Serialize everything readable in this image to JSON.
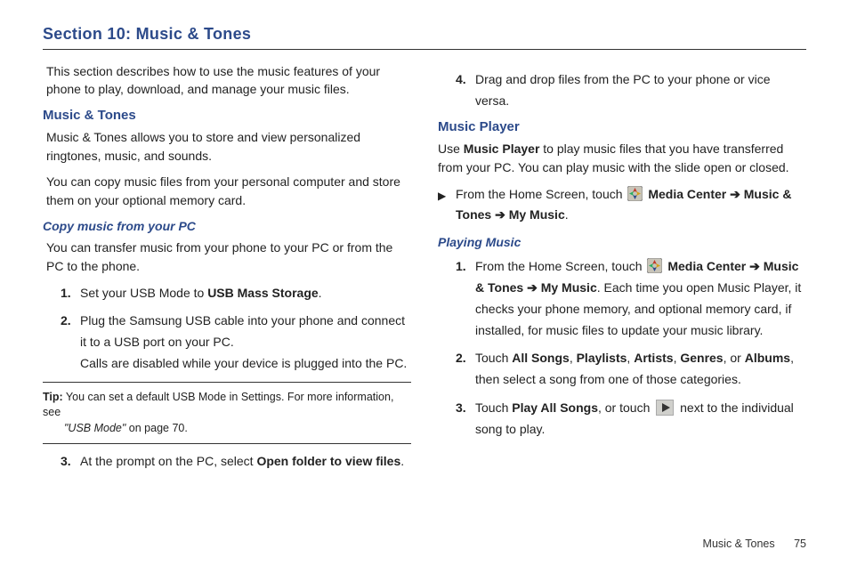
{
  "section_title": "Section 10:  Music & Tones",
  "left": {
    "intro": "This section describes how to use the music features of your phone to play, download, and manage your music files.",
    "h1": "Music & Tones",
    "p1": "Music & Tones allows you to store and view personalized ringtones, music, and sounds.",
    "p2": "You can copy music files from your personal computer and store them on your optional memory card.",
    "h2": "Copy music from your PC",
    "p3": "You can transfer music from your phone to your PC or from the PC to the phone.",
    "steps": {
      "s1_a": "Set your USB Mode to ",
      "s1_b": "USB Mass Storage",
      "s1_c": ".",
      "s2_a": "Plug the Samsung USB cable into your phone and connect it to a USB port on your PC.",
      "s2_b": "Calls are disabled while your device is plugged into the PC.",
      "s3_a": "At the prompt on the PC, select ",
      "s3_b": "Open folder to view files",
      "s3_c": "."
    },
    "tip": {
      "label": "Tip:",
      "line1": " You can set a default USB Mode in Settings. For more information, see",
      "line2a": "\"USB Mode\"",
      "line2b": " on page 70."
    }
  },
  "right": {
    "s4": "Drag and drop files from the PC to your phone or vice versa.",
    "h1": "Music Player",
    "p1a": "Use ",
    "p1b": "Music Player",
    "p1c": " to play music files that you have transferred from your PC. You can play music with the slide open or closed.",
    "bullet": {
      "pre": "From the Home Screen, touch ",
      "mc": "Media Center",
      "mt": "Music & Tones",
      "mm": "My Music",
      "dot": "."
    },
    "h2": "Playing Music",
    "steps": {
      "s1a": "From the Home Screen, touch ",
      "s1_mc": "Media Center",
      "s1_mt": "Music & Tones",
      "s1_mm": "My Music",
      "s1b": ". Each time you open Music Player, it checks your phone memory, and optional memory card, if installed, for music files to update your music library.",
      "s2a": "Touch ",
      "s2_all": "All Songs",
      "s2_pl": "Playlists",
      "s2_ar": "Artists",
      "s2_ge": "Genres",
      "s2_or": ", or ",
      "s2_al": "Albums",
      "s2b": ", then select a song from one of those categories.",
      "s3a": "Touch ",
      "s3_play": "Play All Songs",
      "s3b": ", or touch ",
      "s3c": " next to the individual song to play."
    }
  },
  "arrow": "➔",
  "comma": ", ",
  "footer": {
    "label": "Music & Tones",
    "page": "75"
  }
}
